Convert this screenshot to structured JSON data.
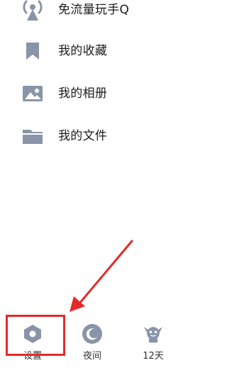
{
  "menu": {
    "items": [
      {
        "label": "免流量玩手Q",
        "icon": "broadcast-icon"
      },
      {
        "label": "我的收藏",
        "icon": "bookmark-icon"
      },
      {
        "label": "我的相册",
        "icon": "image-icon"
      },
      {
        "label": "我的文件",
        "icon": "folder-icon"
      }
    ]
  },
  "bottom": {
    "settings_label": "设置",
    "night_label": "夜间",
    "weather_label": "12天"
  },
  "colors": {
    "icon": "#8a94a8",
    "highlight": "#e32a2a"
  }
}
